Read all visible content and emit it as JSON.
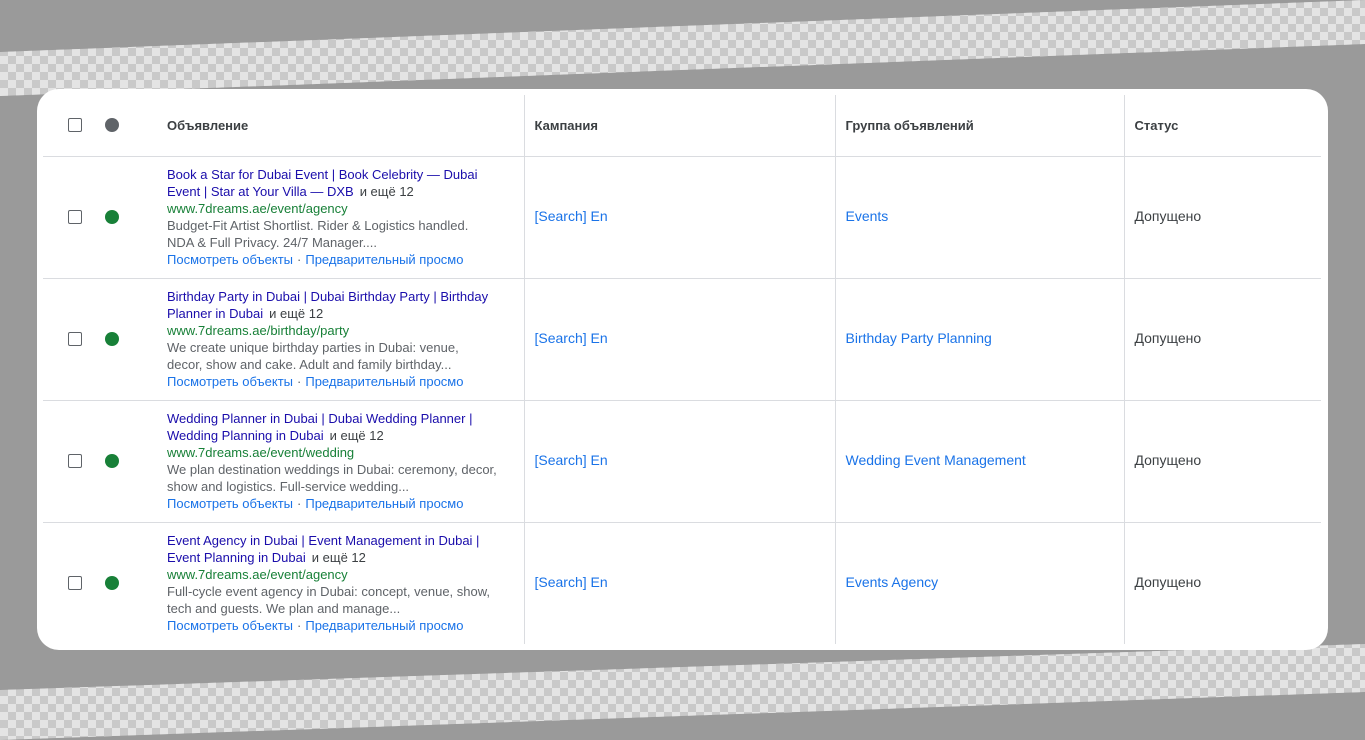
{
  "header": {
    "ad_label": "Объявление",
    "campaign_label": "Кампания",
    "adgroup_label": "Группа объявлений",
    "status_label": "Статус"
  },
  "colors": {
    "status_dot_header": "#5f6368",
    "status_dot_enabled": "#188038",
    "ad_title": "#1a0dab",
    "display_url": "#188038",
    "link": "#1a73e8"
  },
  "rows": [
    {
      "title": "Book a Star for Dubai Event | Book Celebrity — Dubai Event | Star at Your Villa — DXB",
      "more": "и ещё 12",
      "url": "www.7dreams.ae/event/agency",
      "description": "Budget-Fit Artist Shortlist. Rider & Logistics handled. NDA & Full Privacy. 24/7 Manager....",
      "link_assets": "Посмотреть объекты",
      "link_preview": "Предварительный просмо",
      "campaign": "[Search] En",
      "ad_group": "Events",
      "status": "Допущено"
    },
    {
      "title": "Birthday Party in Dubai | Dubai Birthday Party | Birthday Planner in Dubai",
      "more": "и ещё 12",
      "url": "www.7dreams.ae/birthday/party",
      "description": "We create unique birthday parties in Dubai: venue, decor, show and cake. Adult and family birthday...",
      "link_assets": "Посмотреть объекты",
      "link_preview": "Предварительный просмо",
      "campaign": "[Search] En",
      "ad_group": "Birthday Party Planning",
      "status": "Допущено"
    },
    {
      "title": "Wedding Planner in Dubai | Dubai Wedding Planner | Wedding Planning in Dubai",
      "more": "и ещё 12",
      "url": "www.7dreams.ae/event/wedding",
      "description": "We plan destination weddings in Dubai: ceremony, decor, show and logistics. Full-service wedding...",
      "link_assets": "Посмотреть объекты",
      "link_preview": "Предварительный просмо",
      "campaign": "[Search] En",
      "ad_group": "Wedding Event Management",
      "status": "Допущено"
    },
    {
      "title": "Event Agency in Dubai | Event Management in Dubai | Event Planning in Dubai",
      "more": "и ещё 12",
      "url": "www.7dreams.ae/event/agency",
      "description": "Full-cycle event agency in Dubai: concept, venue, show, tech and guests. We plan and manage...",
      "link_assets": "Посмотреть объекты",
      "link_preview": "Предварительный просмо",
      "campaign": "[Search] En",
      "ad_group": "Events Agency",
      "status": "Допущено"
    }
  ]
}
